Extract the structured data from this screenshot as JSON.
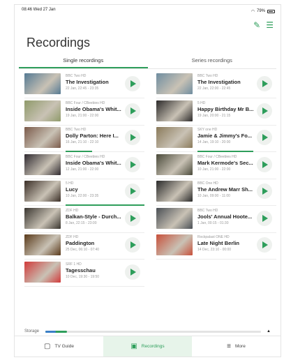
{
  "statusbar": {
    "time": "08:46  Wed 27 Jan",
    "signal": "✓",
    "wifi": "79%"
  },
  "header": {
    "title": "Recordings",
    "edit_icon": "pencil-icon",
    "filter_icon": "sliders-icon"
  },
  "tabs": [
    {
      "label": "Single recordings",
      "active": true
    },
    {
      "label": "Series recordings",
      "active": false
    }
  ],
  "recordings": [
    {
      "channel": "BBC Two HD",
      "title": "The Investigation",
      "time": "22 Jan, 22:45 - 23:35",
      "thumb": "#557a93",
      "progress": 0
    },
    {
      "channel": "BBC Two HD",
      "title": "The Investigation",
      "time": "22 Jan, 22:00 - 22:45",
      "thumb": "#6f8da0",
      "progress": 0
    },
    {
      "channel": "BBC Four / CBeebies HD",
      "title": "Inside Obama's Whit...",
      "time": "19 Jan, 21:00 - 22:00",
      "thumb": "#8f9a6a",
      "progress": 0
    },
    {
      "channel": "5 HD",
      "title": "Happy Birthday Mr B...",
      "time": "19 Jan, 20:00 - 21:15",
      "thumb": "#2c2a2a",
      "progress": 0
    },
    {
      "channel": "BBC Two HD",
      "title": "Dolly Parton: Here I...",
      "time": "16 Jan, 21:10 - 22:10",
      "thumb": "#7b5a4a",
      "progress": 38
    },
    {
      "channel": "SKY one HD",
      "title": "Jamie & Jimmy's Fo...",
      "time": "14 Jan, 19:10 - 20:00",
      "thumb": "#8a7a5a",
      "progress": 80
    },
    {
      "channel": "BBC Four / CBeebies HD",
      "title": "Inside Obama's Whit...",
      "time": "12 Jan, 21:00 - 22:00",
      "thumb": "#2f2a30",
      "progress": 0
    },
    {
      "channel": "BBC Four / CBeebies HD",
      "title": "Mark Kermode's Sec...",
      "time": "10 Jan, 21:00 - 22:00",
      "thumb": "#4a4a3a",
      "progress": 0
    },
    {
      "channel": "5 HD",
      "title": "Lucy",
      "time": "10 Jan, 22:00 - 23:35",
      "thumb": "#3a2e26",
      "progress": 120
    },
    {
      "channel": "BBC One HD",
      "title": "The Andrew Marr Sh...",
      "time": "10 Jan, 09:00 - 11:00",
      "thumb": "#2a2a2a",
      "progress": 0
    },
    {
      "channel": "ZDF HD",
      "title": "Balkan-Style - Durch...",
      "time": "8 Jan, 22:15 - 23:00",
      "thumb": "#3a3630",
      "progress": 0
    },
    {
      "channel": "BBC Two HD",
      "title": "Jools' Annual Hoote...",
      "time": "1 Jan, 00:15 - 01:30",
      "thumb": "#4a4f55",
      "progress": 0
    },
    {
      "channel": "ZDF HD",
      "title": "Paddington",
      "time": "25 Dec, 06:10 - 07:40",
      "thumb": "#5a3a1a",
      "progress": 0
    },
    {
      "channel": "Rockpalast ONE HD",
      "title": "Late Night Berlin",
      "time": "14 Dec, 23:10 - 00:00",
      "thumb": "#c8503a",
      "progress": 0
    },
    {
      "channel": "SRF 1 HD",
      "title": "Tagesschau",
      "time": "10 Dec, 19:30 - 19:50",
      "thumb": "#d13a3a",
      "progress": 0
    }
  ],
  "storage": {
    "label": "Storage",
    "used_fraction": 0.1
  },
  "bottom_nav": [
    {
      "label": "TV Guide",
      "icon": "tv-guide-icon",
      "active": false
    },
    {
      "label": "Recordings",
      "icon": "recordings-icon",
      "active": true
    },
    {
      "label": "More",
      "icon": "menu-icon",
      "active": false
    }
  ]
}
